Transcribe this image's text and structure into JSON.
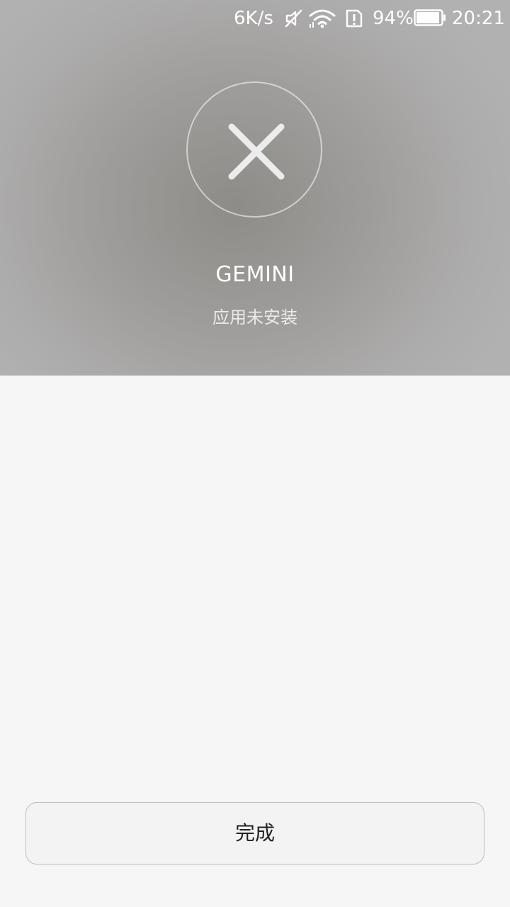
{
  "status_bar": {
    "net_speed": "6K/s",
    "battery_percent": "94%",
    "battery_level": 0.94,
    "time": "20:21",
    "icons": [
      "mute-icon",
      "wifi-icon",
      "sim-alert-icon",
      "battery-icon"
    ]
  },
  "result": {
    "icon": "close-icon",
    "app_name": "GEMINI",
    "status_text": "应用未安装"
  },
  "actions": {
    "done_label": "完成"
  },
  "colors": {
    "header_bg": "#9f9d9b",
    "page_bg": "#f6f6f6",
    "icon_stroke": "#ececec",
    "button_bg": "#f3f3f3",
    "button_border": "#bdbdbd"
  }
}
